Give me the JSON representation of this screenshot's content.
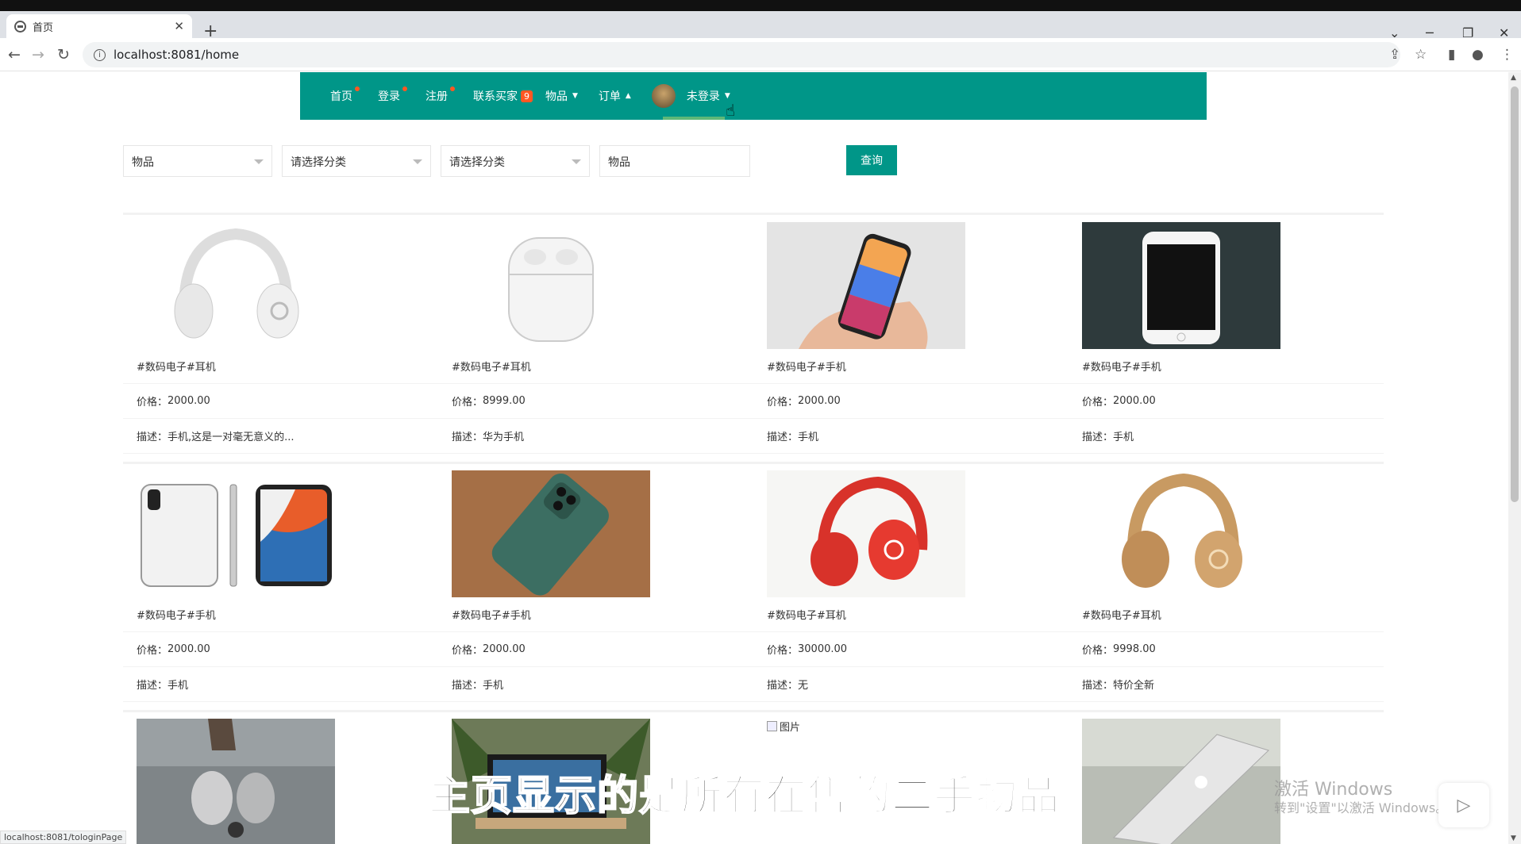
{
  "browser": {
    "tab_title": "首页",
    "url": "localhost:8081/home",
    "status_url": "localhost:8081/tologinPage"
  },
  "navbar": {
    "items": [
      {
        "label": "首页"
      },
      {
        "label": "登录"
      },
      {
        "label": "注册"
      },
      {
        "label": "联系买家",
        "badge": "9"
      },
      {
        "label": "物品"
      },
      {
        "label": "订单"
      },
      {
        "label": "未登录"
      }
    ]
  },
  "filters": {
    "select1": "物品",
    "select2": "请选择分类",
    "select3": "请选择分类",
    "input": "物品",
    "query_label": "查询"
  },
  "labels": {
    "price": "价格：",
    "desc": "描述："
  },
  "products": [
    {
      "tag": "#数码电子#耳机",
      "price": "2000.00",
      "desc": "手机,这是一对毫无意义的...",
      "image": "white-headphones"
    },
    {
      "tag": "#数码电子#耳机",
      "price": "8999.00",
      "desc": "华为手机",
      "image": "airpods-case"
    },
    {
      "tag": "#数码电子#手机",
      "price": "2000.00",
      "desc": "手机",
      "image": "iphone-in-hand"
    },
    {
      "tag": "#数码电子#手机",
      "price": "2000.00",
      "desc": "手机",
      "image": "white-iphone-dark-bg"
    },
    {
      "tag": "#数码电子#手机",
      "price": "2000.00",
      "desc": "手机",
      "image": "iphone-x-front-back"
    },
    {
      "tag": "#数码电子#手机",
      "price": "2000.00",
      "desc": "手机",
      "image": "green-iphone-on-rug"
    },
    {
      "tag": "#数码电子#耳机",
      "price": "30000.00",
      "desc": "无",
      "image": "red-beats-headphones"
    },
    {
      "tag": "#数码电子#耳机",
      "price": "9998.00",
      "desc": "特价全新",
      "image": "gold-beats-headphones"
    }
  ],
  "row3": {
    "broken_alt": "图片"
  },
  "subtitle": "主页显示的是所有在售的二手物品",
  "watermark": {
    "line1": "激活 Windows",
    "line2": "转到\"设置\"以激活 Windows。"
  }
}
